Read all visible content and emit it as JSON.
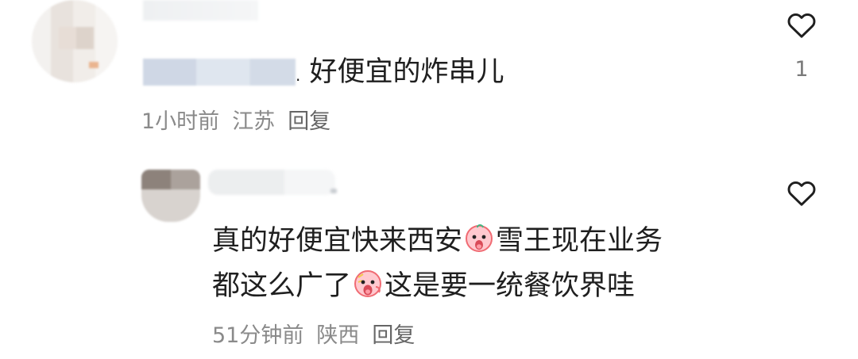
{
  "comment": {
    "text_prefix_dot": ".",
    "text": "好便宜的炸串儿",
    "time": "1小时前",
    "location": "江苏",
    "reply_label": "回复",
    "like_count": "1"
  },
  "reply": {
    "line1_part1": "真的好便宜快来西安",
    "line1_part2": "雪王现在业务",
    "line2_part1": "都这么广了",
    "line2_part2": "这是要一统餐饮界哇",
    "time": "51分钟前",
    "location": "陕西",
    "reply_label": "回复"
  },
  "icons": {
    "like": "heart-outline-icon",
    "emoji_1": "shocked-face-emoji",
    "emoji_2": "shocked-face-emoji"
  },
  "colors": {
    "text": "#1f1f1f",
    "meta": "#8a8a8a",
    "heart": "#1f1f1f",
    "emoji_red": "#ff6b6b",
    "emoji_pink": "#ffd0d0"
  }
}
